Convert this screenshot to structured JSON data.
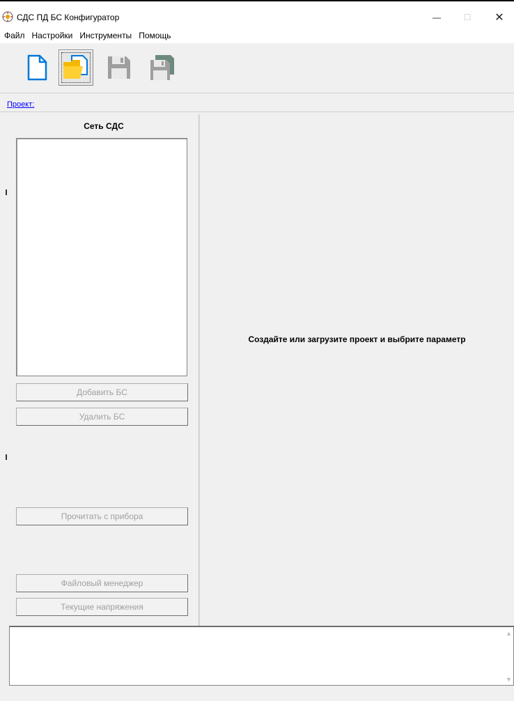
{
  "window": {
    "title": "СДС ПД БС Конфигуратор",
    "minimize_glyph": "—",
    "maximize_glyph": "☐",
    "close_glyph": "✕"
  },
  "menu": {
    "items": [
      "Файл",
      "Настройки",
      "Инструменты",
      "Помощь"
    ]
  },
  "toolbar": {
    "buttons": [
      {
        "icon": "new-file-icon"
      },
      {
        "icon": "open-folder-icon",
        "pressed": true
      },
      {
        "icon": "save-icon"
      },
      {
        "icon": "save-as-icon"
      }
    ]
  },
  "project": {
    "link_label": "Проект:"
  },
  "network_panel": {
    "title": "Сеть СДС",
    "buttons": {
      "add": "Добавить БС",
      "remove": "Удалить БС",
      "read": "Прочитать с прибора",
      "file_manager": "Файловый менеджер",
      "voltages": "Текущие напряжения"
    }
  },
  "main": {
    "placeholder": "Создайте или загрузите проект и выбрите параметр"
  },
  "colors": {
    "link": "#0000ff",
    "disabled_text": "#a0a0a0",
    "folder": "#f5b800",
    "save_icon": "#999999",
    "file_icon": "#0078d7"
  }
}
